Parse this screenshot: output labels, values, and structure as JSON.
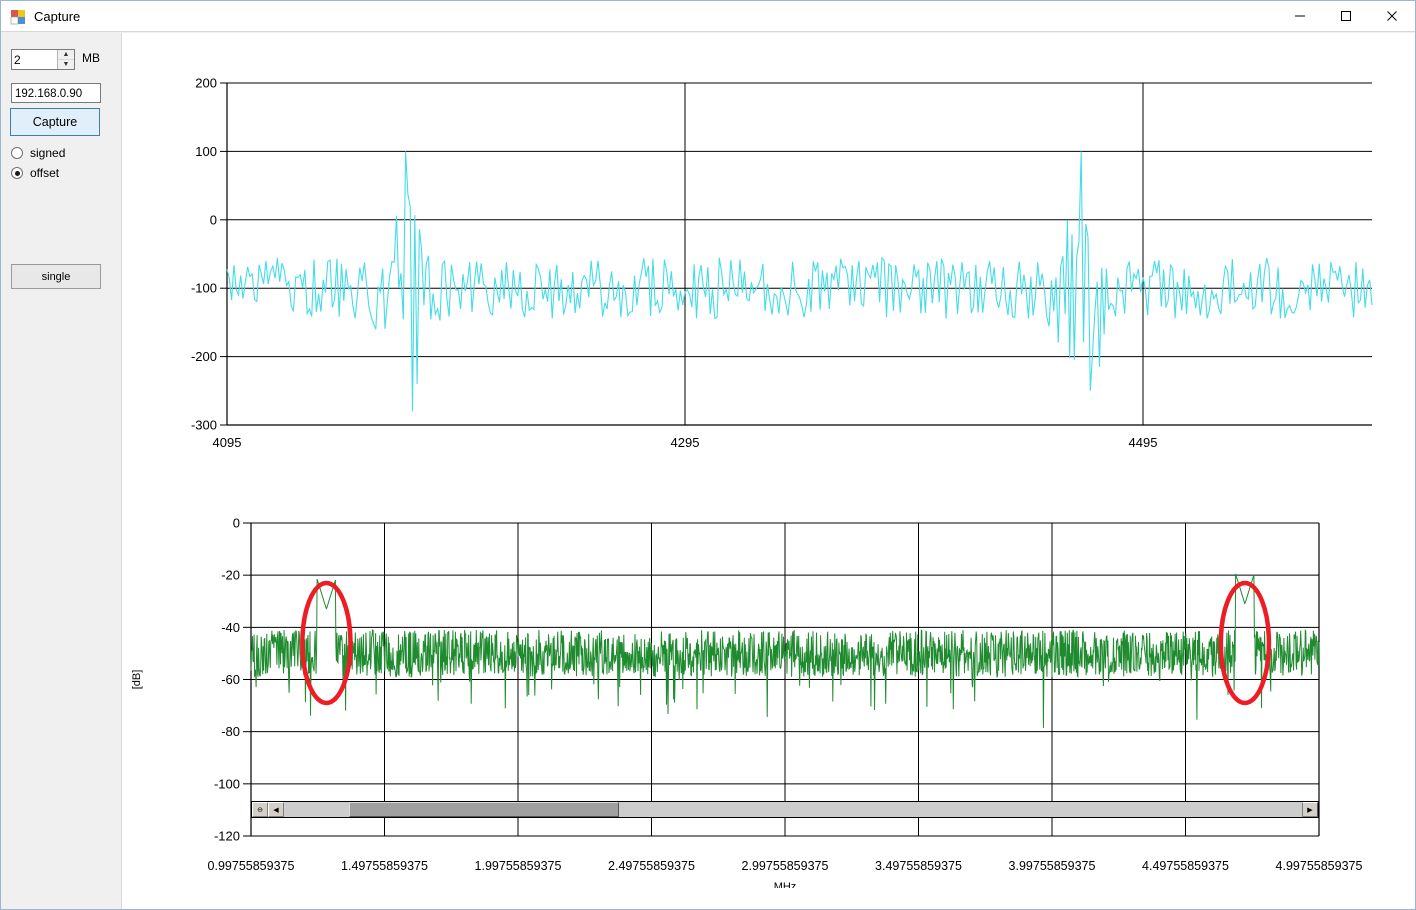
{
  "window": {
    "title": "Capture",
    "icon": "app-window-icon",
    "minimize_label": "minimize-icon",
    "maximize_label": "maximize-icon",
    "close_label": "close-icon"
  },
  "sidebar": {
    "size_value": "2",
    "size_unit": "MB",
    "size_placeholder": "",
    "ip_value": "192.168.0.90",
    "ip_placeholder": "",
    "capture_label": "Capture",
    "radios": [
      {
        "label": "signed",
        "checked": false
      },
      {
        "label": "offset",
        "checked": true
      }
    ],
    "single_label": "single"
  },
  "scrollbar": {
    "zoom_icon": "⊖",
    "left_arrow": "◀",
    "right_arrow": "▶"
  },
  "chart_data": [
    {
      "id": "time-domain",
      "type": "line",
      "title": "",
      "xlabel": "",
      "ylabel": "",
      "series_color": "#45dce8",
      "xlim": [
        4095,
        4595
      ],
      "ylim": [
        -300,
        200
      ],
      "xticks": [
        4095,
        4295,
        4495
      ],
      "xticklabels": [
        "4095",
        "4295",
        "4495"
      ],
      "yticks": [
        200,
        100,
        0,
        -100,
        -200,
        -300
      ],
      "yticklabels": [
        "200",
        "100",
        "0",
        "-100",
        "-200",
        "-300"
      ],
      "grid": true,
      "note": "ADC sample trace, noise centered near -100 with large transient spikes reaching +100 and -280",
      "baseline": -100,
      "noise_amplitude": 45,
      "spikes": [
        {
          "x": 4173,
          "y": 100
        },
        {
          "x": 4176,
          "y": -280
        },
        {
          "x": 4178,
          "y": -240
        },
        {
          "x": 4468,
          "y": 100
        },
        {
          "x": 4472,
          "y": -250
        },
        {
          "x": 4476,
          "y": -215
        }
      ]
    },
    {
      "id": "spectrum",
      "type": "line",
      "title": "",
      "xlabel": "MHz",
      "ylabel": "[dB]",
      "series_color": "#1f8b2f",
      "xlim": [
        0.99755859375,
        4.99755859375
      ],
      "ylim": [
        -120,
        0
      ],
      "xticks": [
        0.99755859375,
        1.49755859375,
        1.99755859375,
        2.49755859375,
        2.99755859375,
        3.49755859375,
        3.99755859375,
        4.49755859375,
        4.99755859375
      ],
      "xticklabels": [
        "0.99755859375",
        "1.49755859375",
        "1.99755859375",
        "2.49755859375",
        "2.99755859375",
        "3.49755859375",
        "3.99755859375",
        "4.49755859375",
        "4.99755859375"
      ],
      "yticks": [
        0,
        -20,
        -40,
        -60,
        -80,
        -100,
        -120
      ],
      "yticklabels": [
        "0",
        "-20",
        "-40",
        "-60",
        "-80",
        "-100",
        "-120"
      ],
      "grid": true,
      "noise_floor": -50,
      "noise_amplitude": 9,
      "peaks": [
        {
          "x": 1.28,
          "y": -33,
          "annotated": true
        },
        {
          "x": 4.72,
          "y": -31,
          "annotated": true
        }
      ],
      "annotations": [
        {
          "shape": "ellipse",
          "color": "#ee1c25",
          "cx": 1.28,
          "cy": -46,
          "rx_mhz": 0.09,
          "ry_db": 23
        },
        {
          "shape": "ellipse",
          "color": "#ee1c25",
          "cx": 4.72,
          "cy": -46,
          "rx_mhz": 0.09,
          "ry_db": 23
        }
      ]
    }
  ]
}
